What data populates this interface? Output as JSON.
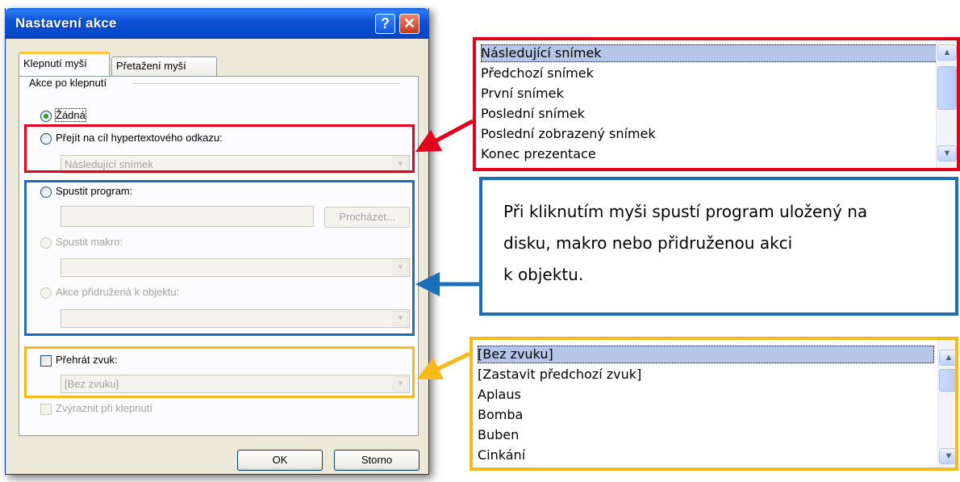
{
  "dialog": {
    "title": "Nastavení akce",
    "help_glyph": "?",
    "close_glyph": "✕",
    "tabs": [
      "Klepnutí myší",
      "Přetažení myší"
    ],
    "group_label": "Akce po klepnutí",
    "radio_none": "Žádná",
    "radio_hyperlink": "Přejít na cíl hypertextového odkazu:",
    "hyperlink_value": "Následující snímek",
    "radio_program": "Spustit program:",
    "browse_button": "Procházet...",
    "radio_macro": "Spustit makro:",
    "radio_object": "Akce přidružená k objektu:",
    "check_sound": "Přehrát zvuk:",
    "sound_value": "[Bez zvuku]",
    "check_highlight": "Zvýraznit při klepnutí",
    "ok_button": "OK",
    "cancel_button": "Storno",
    "selected_action": "Žádná"
  },
  "hyperlink_list": {
    "items": [
      "Následující snímek",
      "Předchozí snímek",
      "První snímek",
      "Poslední snímek",
      "Poslední zobrazený snímek",
      "Konec prezentace"
    ],
    "selected": "Následující snímek"
  },
  "info_box": {
    "lines": [
      "Při kliknutím myši spustí program uložený na",
      "disku, makro nebo přidruženou akci",
      "k objektu."
    ]
  },
  "sound_list": {
    "items": [
      "[Bez zvuku]",
      "[Zastavit předchozí zvuk]",
      "Aplaus",
      "Bomba",
      "Buben",
      "Cinkání"
    ],
    "selected": "[Bez zvuku]"
  },
  "colors": {
    "red": "#e3001b",
    "blue": "#1b6fb8",
    "yellow": "#f7b81a"
  },
  "icons": {
    "scroll_up": "▲",
    "scroll_down": "▼",
    "combo_arrow": "▼"
  }
}
